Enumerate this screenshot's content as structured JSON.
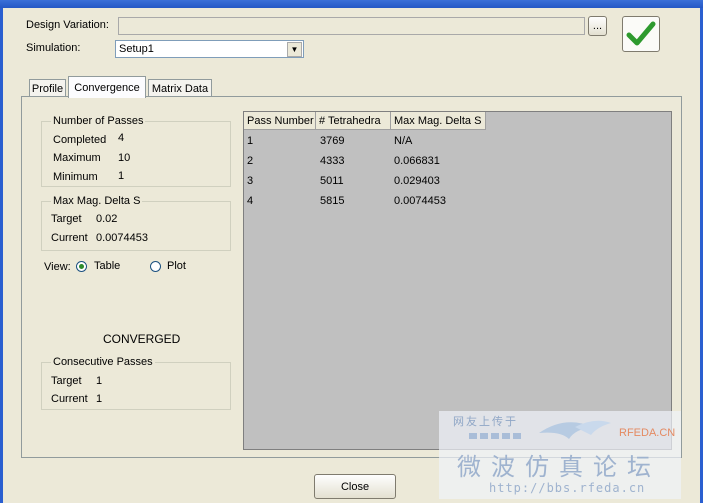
{
  "window": {
    "title_bar": ""
  },
  "header": {
    "design_variation_label": "Design Variation:",
    "design_variation_value": "",
    "browse_label": "...",
    "simulation_label": "Simulation:",
    "simulation_value": "Setup1"
  },
  "tabs": [
    {
      "label": "Profile",
      "active": false
    },
    {
      "label": "Convergence",
      "active": true
    },
    {
      "label": "Matrix Data",
      "active": false
    }
  ],
  "passes": {
    "title": "Number of Passes",
    "completed_label": "Completed",
    "completed_value": "4",
    "maximum_label": "Maximum",
    "maximum_value": "10",
    "minimum_label": "Minimum",
    "minimum_value": "1"
  },
  "delta": {
    "title": "Max Mag. Delta S",
    "target_label": "Target",
    "target_value": "0.02",
    "current_label": "Current",
    "current_value": "0.0074453"
  },
  "view": {
    "label": "View:",
    "table_label": "Table",
    "table_selected": true,
    "plot_label": "Plot",
    "plot_selected": false
  },
  "status": "CONVERGED",
  "consecutive": {
    "title": "Consecutive Passes",
    "target_label": "Target",
    "target_value": "1",
    "current_label": "Current",
    "current_value": "1"
  },
  "table": {
    "columns": [
      "Pass Number",
      "# Tetrahedra",
      "Max Mag. Delta S"
    ],
    "rows": [
      [
        "1",
        "3769",
        "N/A"
      ],
      [
        "2",
        "4333",
        "0.066831"
      ],
      [
        "3",
        "5011",
        "0.029403"
      ],
      [
        "4",
        "5815",
        "0.0074453"
      ]
    ]
  },
  "footer": {
    "close_label": "Close"
  },
  "watermark": {
    "logo_top": "网友上传于",
    "logo_brand": "RFEDA.CN",
    "logo_cn": "微波仿真论坛",
    "logo_url": "http://bbs.rfeda.cn"
  },
  "colors": {
    "accent_check": "#2e9a2e",
    "table_bg": "#c0c0c0",
    "window_frame": "#2a5fd0"
  }
}
